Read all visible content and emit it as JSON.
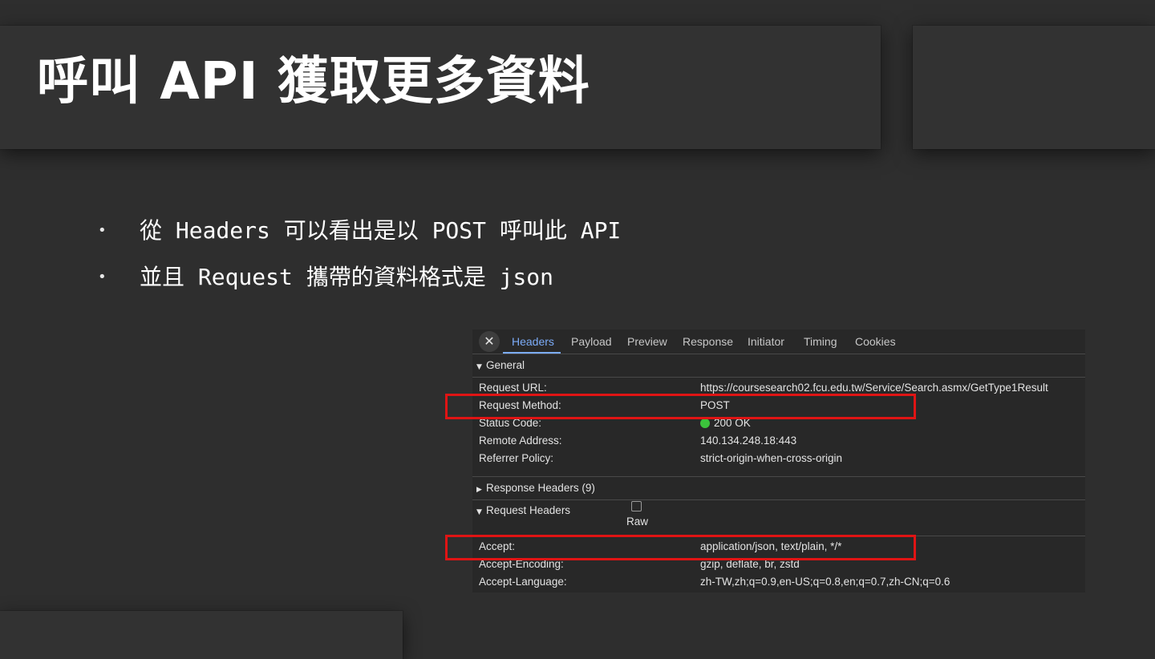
{
  "slide": {
    "title": "呼叫 API 獲取更多資料",
    "bullets": [
      "從 Headers 可以看出是以 POST 呼叫此 API",
      "並且 Request 攜帶的資料格式是 json"
    ],
    "bullet_symbol": "•"
  },
  "devtools": {
    "close_symbol": "✕",
    "tabs": [
      "Headers",
      "Payload",
      "Preview",
      "Response",
      "Initiator",
      "Timing",
      "Cookies"
    ],
    "active_tab": "Headers",
    "general": {
      "label": "General",
      "expanded_arrow": "▼",
      "rows": [
        {
          "key": "Request URL:",
          "value": "https://coursesearch02.fcu.edu.tw/Service/Search.asmx/GetType1Result"
        },
        {
          "key": "Request Method:",
          "value": "POST"
        },
        {
          "key": "Status Code:",
          "value": "200 OK"
        },
        {
          "key": "Remote Address:",
          "value": "140.134.248.18:443"
        },
        {
          "key": "Referrer Policy:",
          "value": "strict-origin-when-cross-origin"
        }
      ]
    },
    "response_headers": {
      "label": "Response Headers (9)",
      "collapsed_arrow": "▶"
    },
    "request_headers": {
      "label": "Request Headers",
      "expanded_arrow": "▼",
      "raw_label": "Raw",
      "rows": [
        {
          "key": "Accept:",
          "value": "application/json, text/plain, */*"
        },
        {
          "key": "Accept-Encoding:",
          "value": "gzip, deflate, br, zstd"
        },
        {
          "key": "Accept-Language:",
          "value": "zh-TW,zh;q=0.9,en-US;q=0.8,en;q=0.7,zh-CN;q=0.6"
        }
      ]
    },
    "colors": {
      "highlight": "#e01414",
      "active_tab": "#7cacf8",
      "status_ok": "#3cc33c"
    }
  }
}
